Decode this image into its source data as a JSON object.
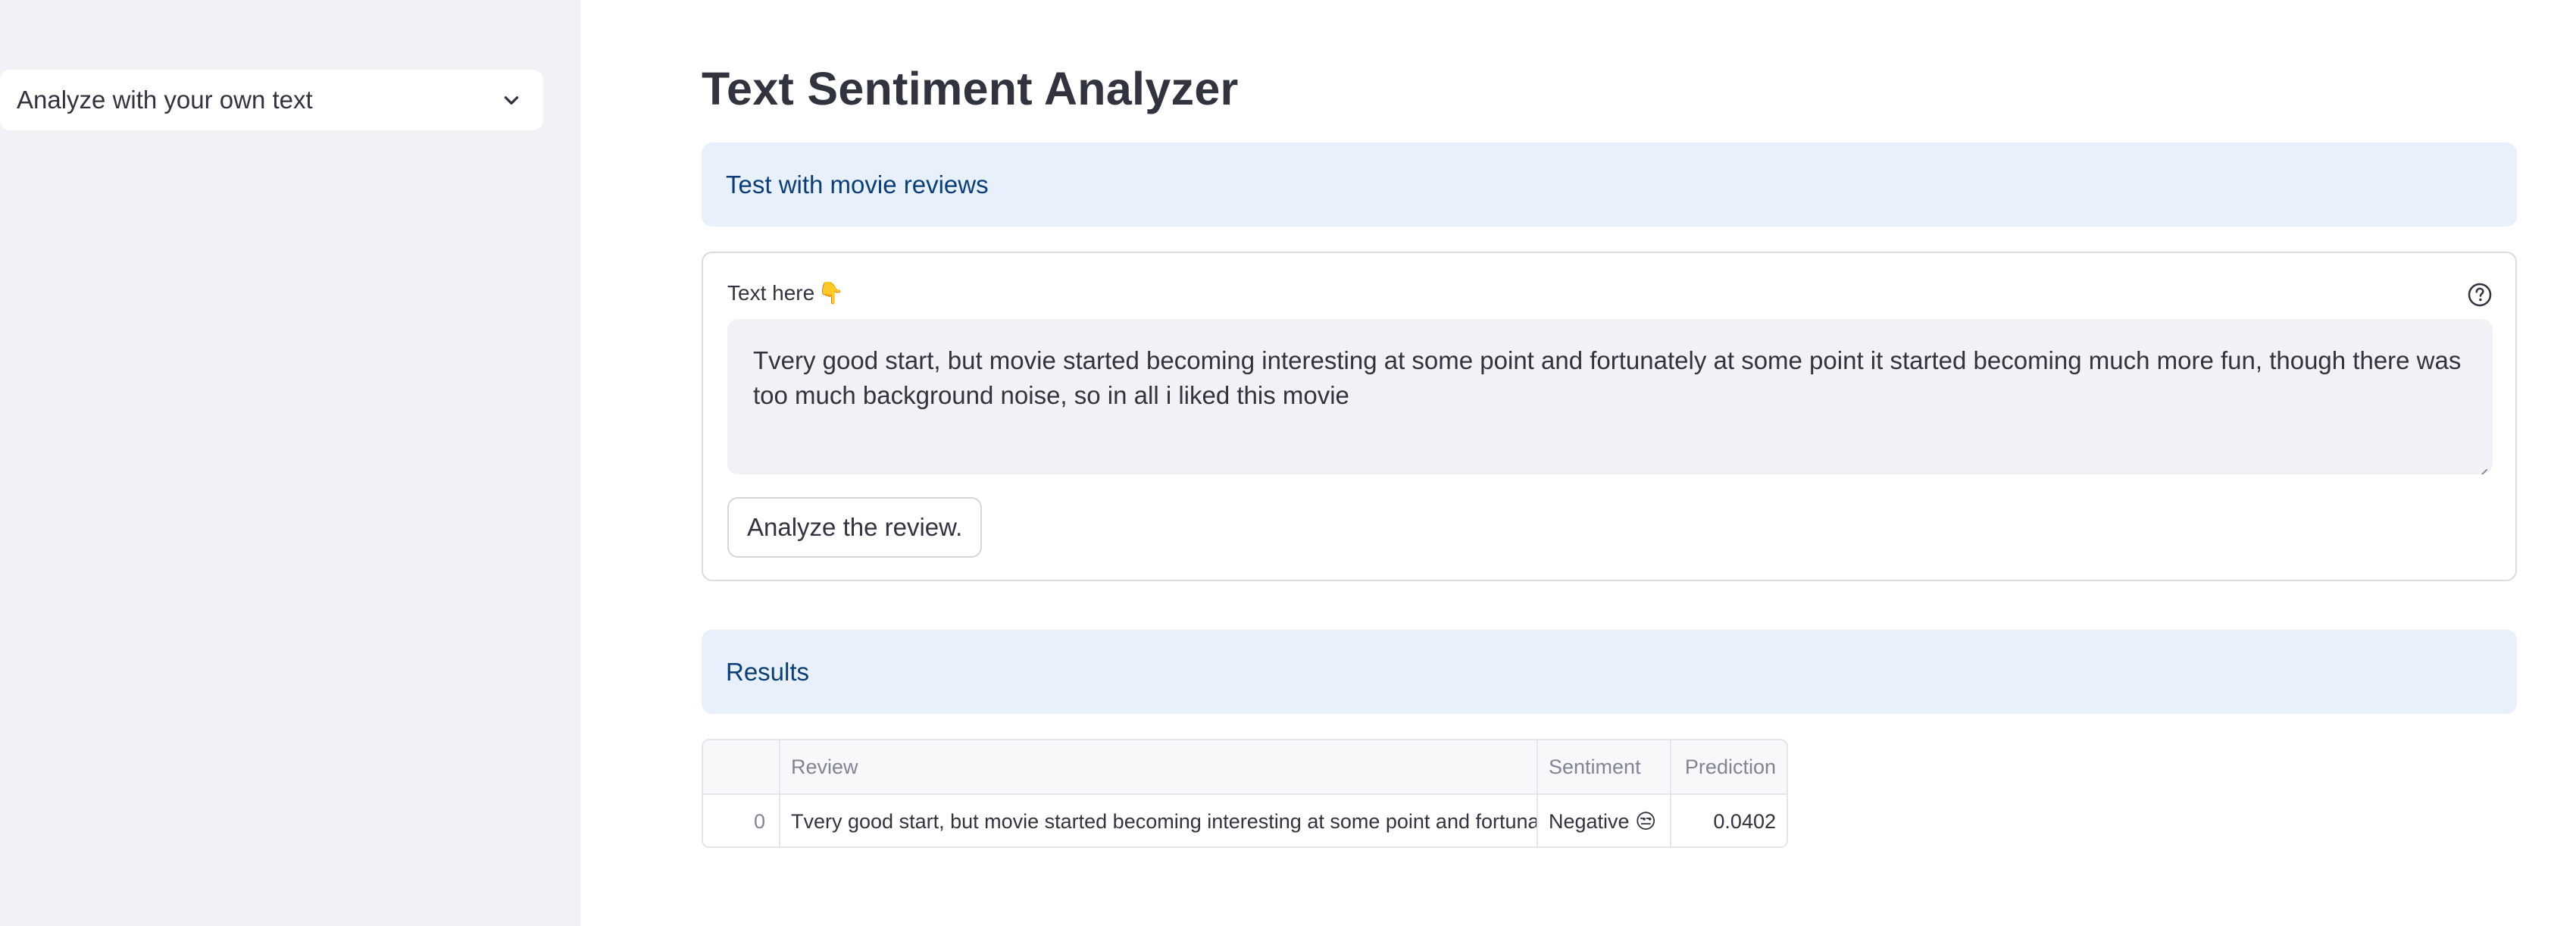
{
  "sidebar": {
    "select_value": "Analyze with your own text",
    "select_icon": "chevron-down-icon"
  },
  "main": {
    "title": "Text Sentiment Analyzer",
    "section_header": "Test with movie reviews",
    "form": {
      "label": "Text here",
      "label_emoji": "👇",
      "help_icon": "question-circle-icon",
      "textarea_value": "Tvery good start, but movie started becoming interesting at some point and fortunately at some point it started becoming much more fun, though there was too much background noise, so in all i liked this movie",
      "submit_label": "Analyze the review."
    },
    "results_header": "Results",
    "table": {
      "columns": [
        "",
        "Review",
        "Sentiment",
        "Prediction"
      ],
      "rows": [
        {
          "index": "0",
          "review": "Tvery good start, but movie started becoming interesting at some point and fortunately at some point it started becoming much more fun, though there was too much background noise, so in all i liked this movie",
          "sentiment": "Negative 😒",
          "prediction": "0.0402"
        }
      ]
    }
  },
  "colors": {
    "sidebar_bg": "#f0f2f6",
    "info_bg": "#e8f0fb",
    "info_text": "#0b3e77",
    "text": "#31333f"
  }
}
